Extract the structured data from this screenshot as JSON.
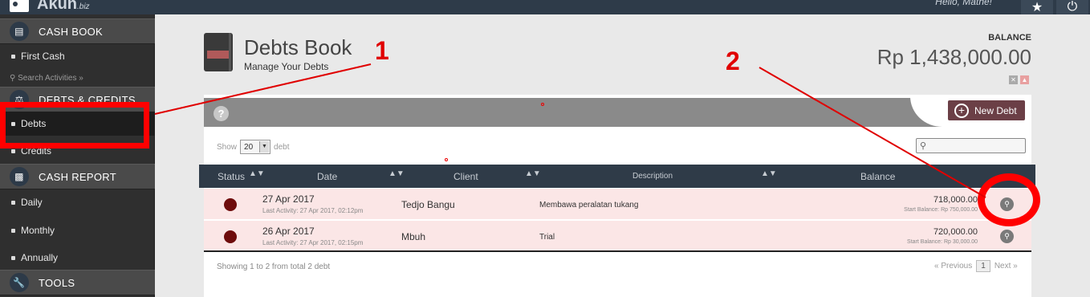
{
  "topbar": {
    "logo_text": "Akun",
    "logo_suffix": ".biz",
    "hello": "Hello, Mathe!",
    "star_icon": "star-icon",
    "power_icon": "power-icon"
  },
  "sidebar": {
    "cash_book": "CASH BOOK",
    "first_cash": "First Cash",
    "search": "Search Activities »",
    "debts_credits": "DEBTS & CREDITS",
    "debts": "Debts",
    "credits": "Credits",
    "cash_report": "CASH REPORT",
    "daily": "Daily",
    "monthly": "Monthly",
    "annually": "Annually",
    "tools": "TOOLS"
  },
  "header": {
    "title": "Debts Book",
    "subtitle": "Manage Your Debts",
    "balance_label": "BALANCE",
    "balance_value": "Rp 1,438,000.00"
  },
  "panel": {
    "help": "?",
    "new_debt": "New Debt",
    "show_label": "Show",
    "show_value": "20",
    "show_unit": "debt",
    "search_placeholder": ""
  },
  "table": {
    "headers": {
      "status": "Status",
      "date": "Date",
      "client": "Client",
      "description": "Description",
      "balance": "Balance"
    },
    "rows": [
      {
        "date": "27 Apr 2017",
        "last_activity": "Last Activity: 27 Apr 2017, 02:12pm",
        "client": "Tedjo Bangu",
        "description": "Membawa peralatan tukang",
        "balance": "718,000.00",
        "start_balance": "Start Balance: Rp 750,000.00"
      },
      {
        "date": "26 Apr 2017",
        "last_activity": "Last Activity: 27 Apr 2017, 02:15pm",
        "client": "Mbuh",
        "description": "Trial",
        "balance": "720,000.00",
        "start_balance": "Start Balance: Rp 30,000.00"
      }
    ],
    "footer": "Showing 1 to 2 from total 2 debt",
    "prev": "« Previous",
    "page": "1",
    "next": "Next »"
  },
  "annotations": {
    "label_1": "1",
    "label_2": "2"
  }
}
